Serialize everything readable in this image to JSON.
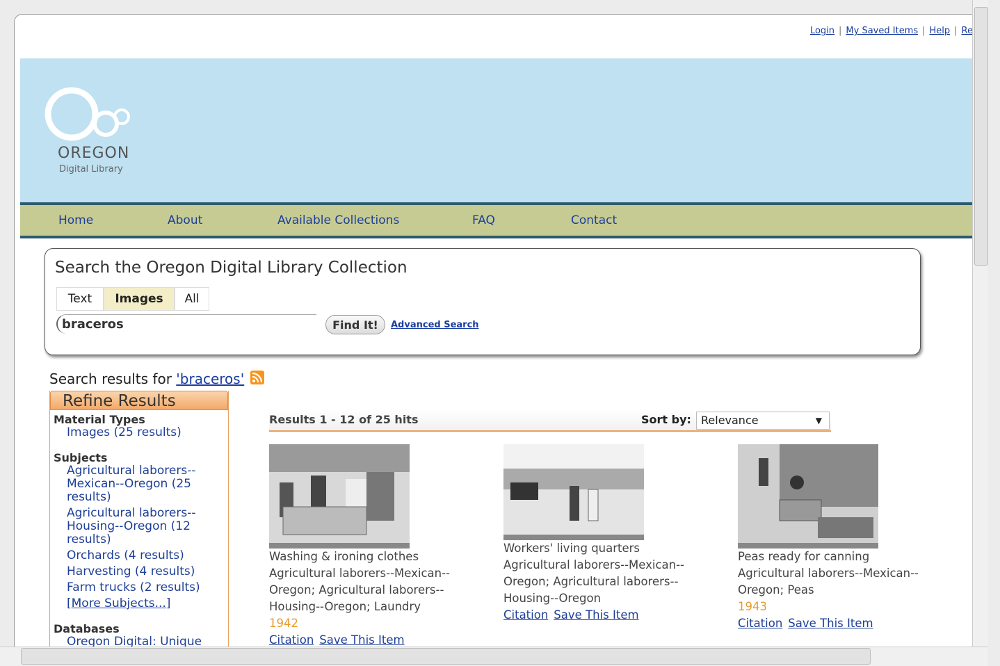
{
  "util_links": [
    "Login",
    "My Saved Items",
    "Help",
    "Re"
  ],
  "logo": {
    "word": "OREGON",
    "sub": "Digital Library"
  },
  "nav": [
    "Home",
    "About",
    "Available Collections",
    "FAQ",
    "Contact"
  ],
  "search": {
    "title": "Search the Oregon Digital Library Collection",
    "tabs": [
      "Text",
      "Images",
      "All"
    ],
    "active_tab": "Images",
    "query": "braceros",
    "find_label": "Find It!",
    "advanced_label": "Advanced Search"
  },
  "results_for": {
    "prefix": "Search results for ",
    "query": "'braceros'"
  },
  "refine": {
    "title": "Refine Results",
    "groups": [
      {
        "heading": "Material Types",
        "items": [
          "Images (25 results)"
        ]
      },
      {
        "heading": "Subjects",
        "items": [
          "Agricultural laborers--Mexican--Oregon (25 results)",
          "Agricultural laborers--Housing--Oregon (12 results)",
          "Orchards (4 results)",
          "Harvesting (4 results)",
          "Farm trucks (2 results)"
        ],
        "more": "[More Subjects...]"
      },
      {
        "heading": "Databases",
        "items": [
          "Oregon Digital: Unique"
        ]
      }
    ]
  },
  "results_bar": {
    "count": "Results 1 - 12 of 25 hits",
    "sort_label": "Sort by:",
    "sort_value": "Relevance"
  },
  "results": [
    {
      "title": "Washing & ironing clothes",
      "subjects": "Agricultural laborers--Mexican--Oregon; Agricultural laborers--Housing--Oregon; Laundry",
      "date": "1942",
      "citation": "Citation",
      "save": "Save This Item"
    },
    {
      "title": "Workers' living quarters",
      "subjects": "Agricultural laborers--Mexican--Oregon; Agricultural laborers--Housing--Oregon",
      "date": "",
      "citation": "Citation",
      "save": "Save This Item"
    },
    {
      "title": "Peas ready for canning",
      "subjects": "Agricultural laborers--Mexican--Oregon; Peas",
      "date": "1943",
      "citation": "Citation",
      "save": "Save This Item"
    }
  ],
  "colors": {
    "banner": "#bfe1f2",
    "nav": "#c6cb93",
    "nav_border": "#2f5a6e",
    "link": "#1e3f97",
    "accent": "#e89a2e"
  }
}
